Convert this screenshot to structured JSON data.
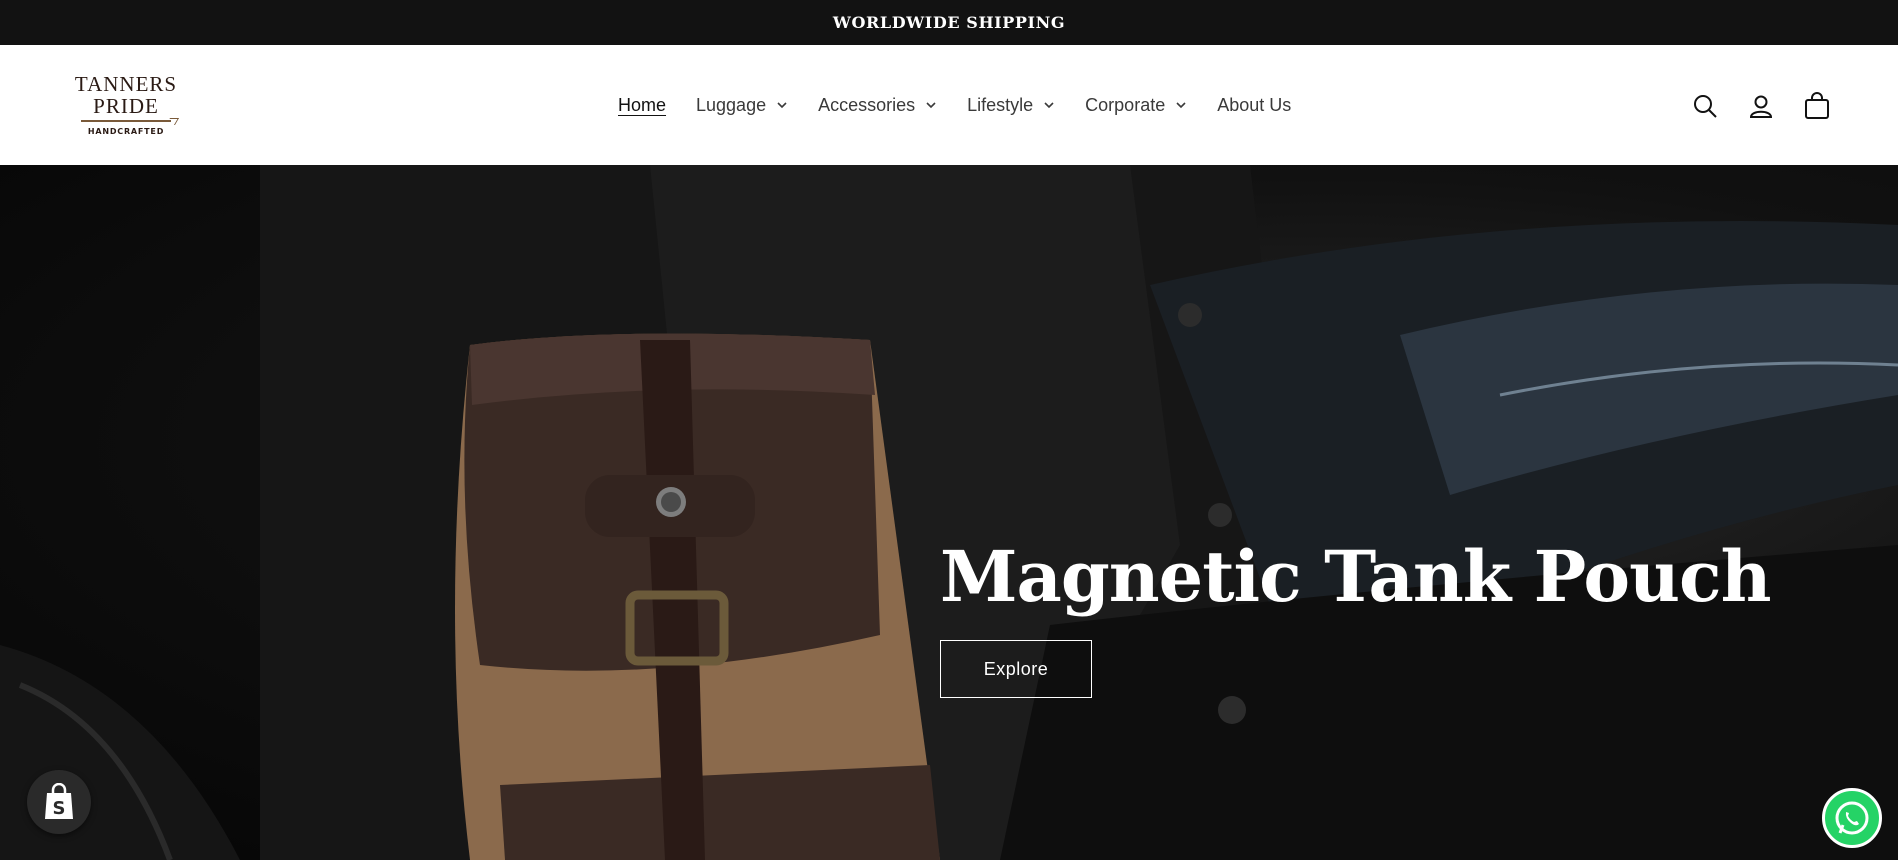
{
  "announcement": {
    "text": "WORLDWIDE SHIPPING"
  },
  "logo": {
    "line1": "TANNERS",
    "line2": "PRIDE",
    "line3": "HANDCRAFTED"
  },
  "nav": {
    "items": [
      {
        "label": "Home",
        "active": true,
        "dropdown": false
      },
      {
        "label": "Luggage",
        "dropdown": true
      },
      {
        "label": "Accessories",
        "dropdown": true
      },
      {
        "label": "Lifestyle",
        "dropdown": true
      },
      {
        "label": "Corporate",
        "dropdown": true
      },
      {
        "label": "About Us",
        "dropdown": false
      }
    ]
  },
  "header_icons": [
    "search-icon",
    "account-icon",
    "cart-icon"
  ],
  "hero": {
    "title": "Magnetic Tank Pouch",
    "cta_label": "Explore"
  },
  "colors": {
    "announcement_bg": "#121212",
    "header_bg": "#ffffff",
    "text_primary": "#121212",
    "whatsapp_green": "#25d366"
  }
}
